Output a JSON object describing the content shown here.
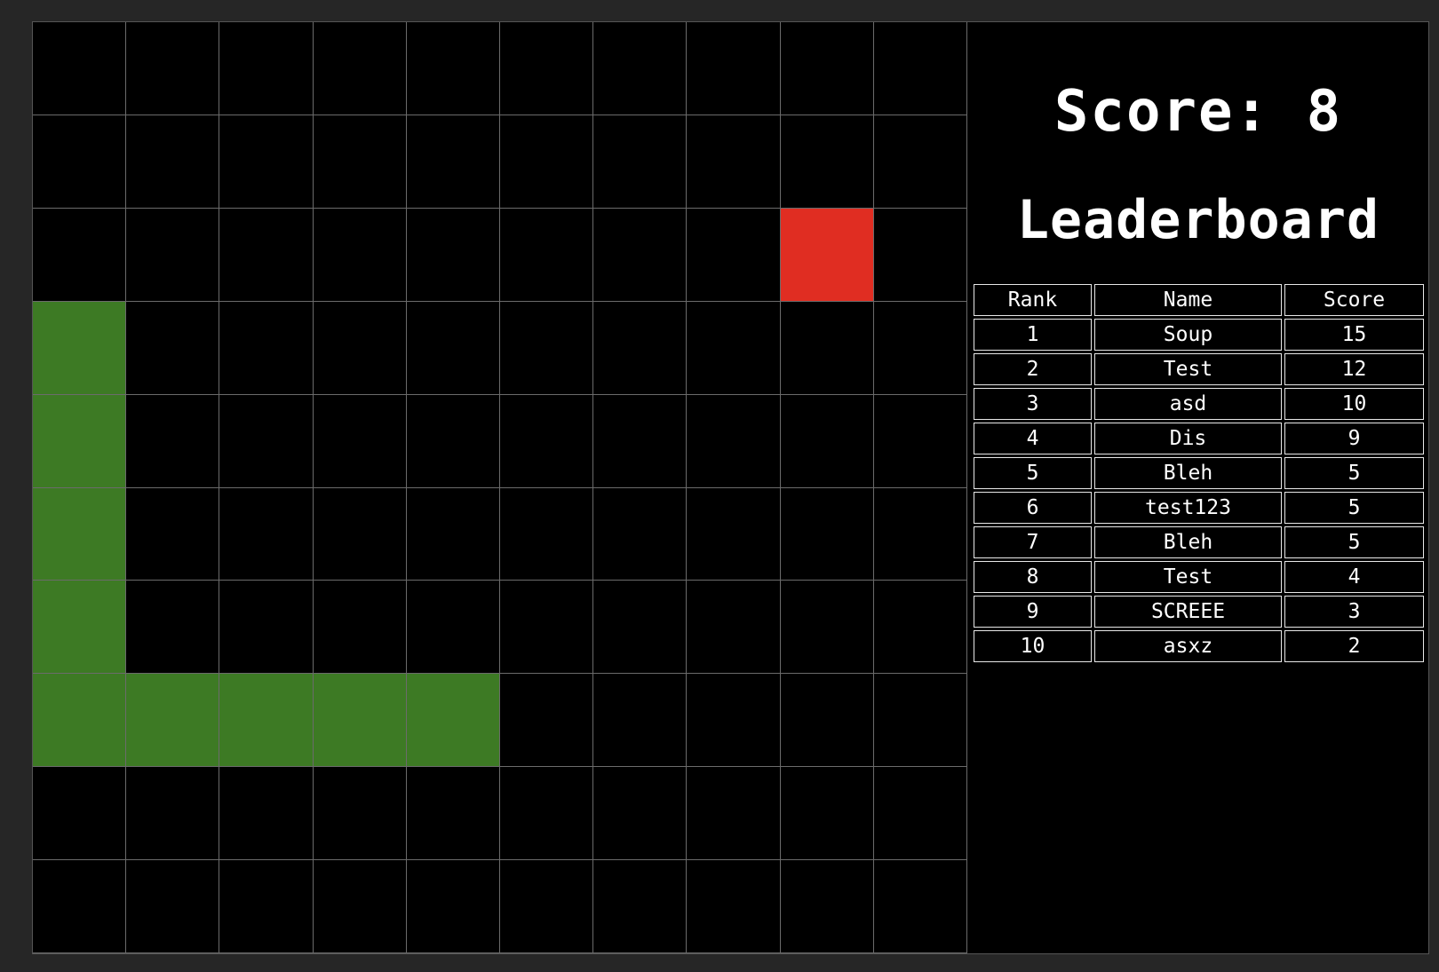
{
  "game": {
    "grid_cols": 10,
    "grid_rows": 10,
    "colors": {
      "background": "#000000",
      "grid_line": "#6b6b6b",
      "snake": "#3d7a24",
      "food": "#e02d22",
      "text": "#ffffff"
    },
    "snake": [
      {
        "col": 0,
        "row": 3
      },
      {
        "col": 0,
        "row": 4
      },
      {
        "col": 0,
        "row": 5
      },
      {
        "col": 0,
        "row": 6
      },
      {
        "col": 0,
        "row": 7
      },
      {
        "col": 1,
        "row": 7
      },
      {
        "col": 2,
        "row": 7
      },
      {
        "col": 3,
        "row": 7
      },
      {
        "col": 4,
        "row": 7
      }
    ],
    "food": {
      "col": 8,
      "row": 2
    }
  },
  "score": {
    "label": "Score: 8",
    "value": 8
  },
  "leaderboard": {
    "title": "Leaderboard",
    "headers": {
      "rank": "Rank",
      "name": "Name",
      "score": "Score"
    },
    "rows": [
      {
        "rank": "1",
        "name": "Soup",
        "score": "15"
      },
      {
        "rank": "2",
        "name": "Test",
        "score": "12"
      },
      {
        "rank": "3",
        "name": "asd",
        "score": "10"
      },
      {
        "rank": "4",
        "name": "Dis",
        "score": "9"
      },
      {
        "rank": "5",
        "name": "Bleh",
        "score": "5"
      },
      {
        "rank": "6",
        "name": "test123",
        "score": "5"
      },
      {
        "rank": "7",
        "name": "Bleh",
        "score": "5"
      },
      {
        "rank": "8",
        "name": "Test",
        "score": "4"
      },
      {
        "rank": "9",
        "name": "SCREEE",
        "score": "3"
      },
      {
        "rank": "10",
        "name": "asxz",
        "score": "2"
      }
    ]
  }
}
